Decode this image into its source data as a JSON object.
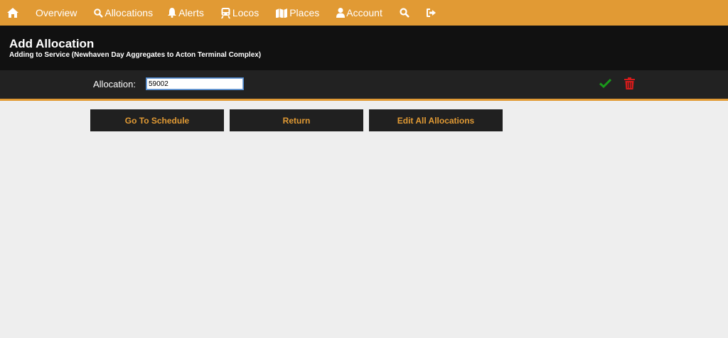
{
  "nav": {
    "items": [
      {
        "id": "home",
        "label": "",
        "icon": "home-icon"
      },
      {
        "id": "overview",
        "label": "Overview",
        "icon": ""
      },
      {
        "id": "allocations",
        "label": "Allocations",
        "icon": "magnify-icon"
      },
      {
        "id": "alerts",
        "label": "Alerts",
        "icon": "bell-icon"
      },
      {
        "id": "locos",
        "label": "Locos",
        "icon": "train-icon"
      },
      {
        "id": "places",
        "label": "Places",
        "icon": "map-icon"
      },
      {
        "id": "account",
        "label": "Account",
        "icon": "user-icon"
      },
      {
        "id": "search",
        "label": "",
        "icon": "search-icon"
      },
      {
        "id": "logout",
        "label": "",
        "icon": "sign-out-icon"
      }
    ]
  },
  "header": {
    "title": "Add Allocation",
    "subtitle": "Adding to Service (Newhaven Day Aggregates to Acton Terminal Complex)"
  },
  "form": {
    "label": "Allocation:",
    "value": "59002"
  },
  "actions": {
    "schedule": "Go To Schedule",
    "return": "Return",
    "edit_all": "Edit All Allocations"
  },
  "colors": {
    "accent": "#e19a34",
    "header_bg": "#111111",
    "row_bg": "#222222",
    "confirm": "#1a9a1a",
    "delete": "#d81b1b"
  }
}
